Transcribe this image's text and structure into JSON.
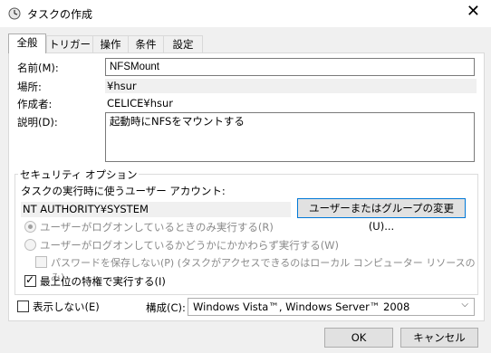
{
  "window": {
    "title": "タスクの作成",
    "icon": "task-clock-icon",
    "close_glyph": "✕"
  },
  "tabs": [
    {
      "label": "全般",
      "active": true
    },
    {
      "label": "トリガー"
    },
    {
      "label": "操作"
    },
    {
      "label": "条件"
    },
    {
      "label": "設定"
    }
  ],
  "general": {
    "name_label": "名前(M):",
    "name_value": "NFSMount",
    "location_label": "場所:",
    "location_value": "¥hsur",
    "author_label": "作成者:",
    "author_value": "CELICE¥hsur",
    "description_label": "説明(D):",
    "description_value": "起動時にNFSをマウントする"
  },
  "security": {
    "group_title": "セキュリティ オプション",
    "account_label": "タスクの実行時に使うユーザー アカウント:",
    "account_value": "NT AUTHORITY¥SYSTEM",
    "change_button": "ユーザーまたはグループの変更(U)...",
    "radio_logged_on": "ユーザーがログオンしているときのみ実行する(R)",
    "radio_whether": "ユーザーがログオンしているかどうかにかかわらず実行する(W)",
    "no_store_password": "パスワードを保存しない(P) (タスクがアクセスできるのはローカル コンピューター リソースのみ)",
    "highest_privileges": "最上位の特権で実行する(I)"
  },
  "bottom": {
    "hidden_label": "表示しない(E)",
    "config_label": "構成(C):",
    "config_value": "Windows Vista™, Windows Server™ 2008",
    "ok": "OK",
    "cancel": "キャンセル"
  }
}
